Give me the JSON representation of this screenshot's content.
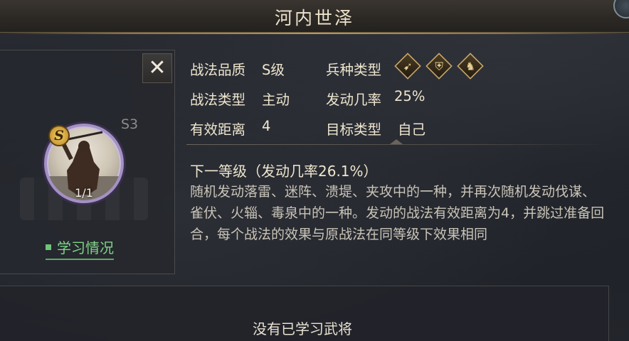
{
  "title": "河内世泽",
  "skill": {
    "level_tag": "S3",
    "badge": "S",
    "count": "1/1",
    "learn_link": "学习情况",
    "close_symbol": "✕"
  },
  "info": {
    "quality_label": "战法品质",
    "quality_value": "S级",
    "unit_type_label": "兵种类型",
    "unit_icons": [
      "crossbow-icon",
      "shield-icon",
      "cavalry-icon"
    ],
    "skill_type_label": "战法类型",
    "skill_type_value": "主动",
    "trigger_rate_label": "发动几率",
    "trigger_rate_value": "25%",
    "range_label": "有效距离",
    "range_value": "4",
    "target_label": "目标类型",
    "target_value": "自己"
  },
  "next_level": "下一等级（发动几率26.1%）",
  "description": "随机发动落雷、迷阵、溃堤、夹攻中的一种，并再次随机发动伐谋、雀伏、火辎、毒泉中的一种。发动的战法有效距离为4，并跳过准备回合，每个战法的效果与原战法在同等级下效果相同",
  "bottom_text": "没有已学习武将",
  "colors": {
    "accent_gold": "#c9a968",
    "learn_green": "#7fd488",
    "portrait_ring": "#a391c4"
  }
}
